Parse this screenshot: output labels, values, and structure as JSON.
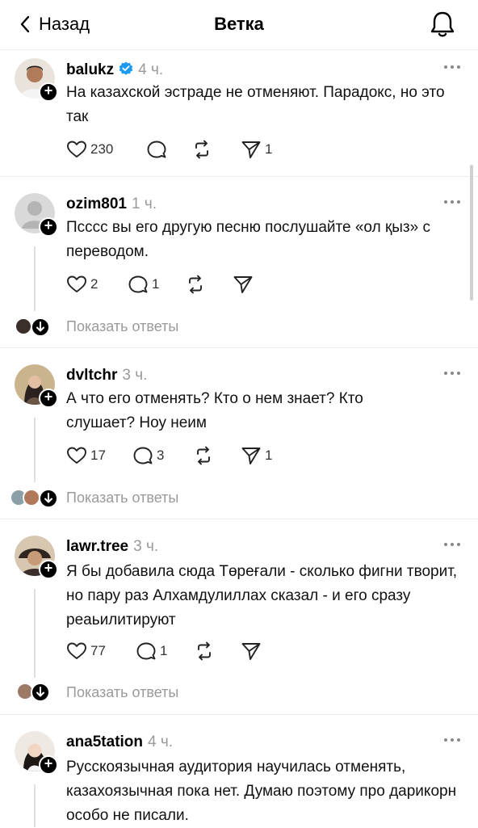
{
  "header": {
    "back_label": "Назад",
    "title": "Ветка"
  },
  "posts": [
    {
      "username": "balukz",
      "time": "4 ч.",
      "verified": true,
      "text": "На казахской эстраде не отменяют. Парадокс, но это так",
      "likes": "230",
      "comments": "",
      "reposts": "",
      "shares": "1"
    },
    {
      "username": "ozim801",
      "time": "1 ч.",
      "text": "Псссс вы его другую песню послушайте «ол қыз» с переводом.",
      "likes": "2",
      "comments": "1",
      "reposts": "",
      "shares": "",
      "show_replies": "Показать ответы"
    },
    {
      "username": "dvltchr",
      "time": "3 ч.",
      "text": "А что его отменять? Кто о нем знает? Кто слушает? Ноу неим",
      "likes": "17",
      "comments": "3",
      "reposts": "",
      "shares": "1",
      "show_replies": "Показать ответы"
    },
    {
      "username": "lawr.tree",
      "time": "3 ч.",
      "text": "Я бы добавила сюда Төреғали - сколько фигни творит, но пару раз Алхамдулиллах сказал - и его сразу реаьилитируют",
      "likes": "77",
      "comments": "1",
      "reposts": "",
      "shares": "",
      "show_replies": "Показать ответы"
    },
    {
      "username": "ana5tation",
      "time": "4 ч.",
      "text": "Русскоязычная аудитория научилась отменять, казахоязычная пока нет. Думаю поэтому про дарикорн особо не писали."
    }
  ],
  "icons": {
    "back": "chevron-left-icon",
    "bell": "bell-icon",
    "more": "more-horizontal-icon",
    "like": "heart-icon",
    "comment": "comment-icon",
    "repost": "repost-icon",
    "share": "send-icon",
    "verified": "verified-badge-icon"
  },
  "colors": {
    "verified": "#1d9bf0",
    "muted": "#9a9a9a",
    "separator": "#ececec"
  }
}
